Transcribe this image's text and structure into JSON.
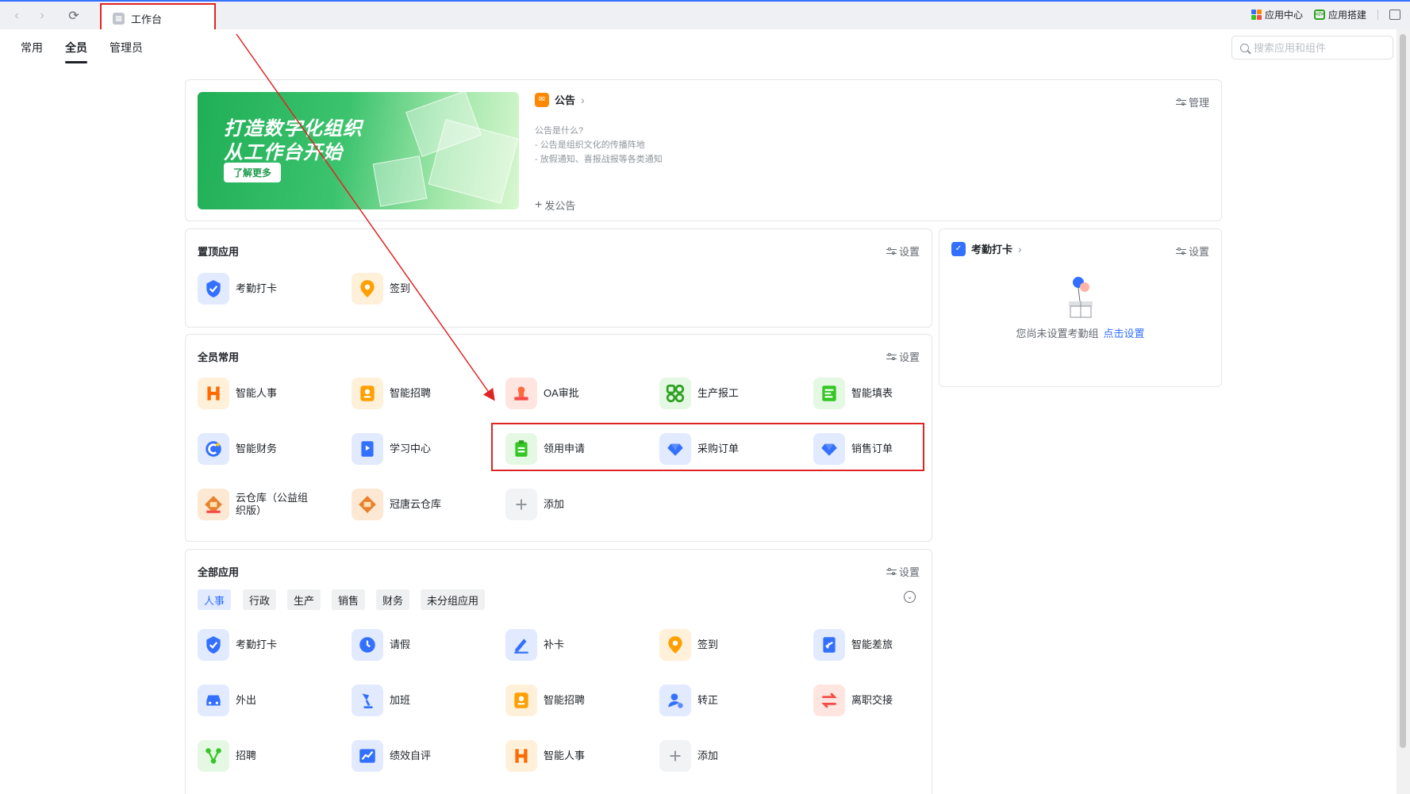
{
  "browser": {
    "tab_label": "工作台",
    "top_actions": [
      "应用中心",
      "应用搭建"
    ]
  },
  "subnav": {
    "tabs": [
      "常用",
      "全员",
      "管理员"
    ],
    "active_tab": "全员",
    "search_placeholder": "搜索应用和组件"
  },
  "banner": {
    "line1": "打造数字化组织",
    "line2": "从工作台开始",
    "button": "了解更多"
  },
  "announcement": {
    "title": "公告",
    "manage": "管理",
    "lines": [
      "公告是什么?",
      "- 公告是组织文化的传播阵地",
      "- 放假通知、喜报战报等各类通知"
    ],
    "post": "发公告"
  },
  "pinned": {
    "title": "置顶应用",
    "setting": "设置",
    "apps": [
      {
        "label": "考勤打卡",
        "icon": "shield-check-icon"
      },
      {
        "label": "签到",
        "icon": "location-pin-icon"
      }
    ]
  },
  "attendance": {
    "title": "考勤打卡",
    "setting": "设置",
    "empty_text": "您尚未设置考勤组",
    "empty_link": "点击设置"
  },
  "common": {
    "title": "全员常用",
    "setting": "设置",
    "apps": [
      {
        "label": "智能人事",
        "icon": "h-logo-icon"
      },
      {
        "label": "智能招聘",
        "icon": "badge-icon"
      },
      {
        "label": "OA审批",
        "icon": "stamp-icon"
      },
      {
        "label": "生产报工",
        "icon": "grid-88-icon"
      },
      {
        "label": "智能填表",
        "icon": "form-icon"
      },
      {
        "label": "智能财务",
        "icon": "finance-icon"
      },
      {
        "label": "学习中心",
        "icon": "book-icon"
      },
      {
        "label": "领用申请",
        "icon": "clipboard-icon"
      },
      {
        "label": "采购订单",
        "icon": "diamond-heart-icon"
      },
      {
        "label": "销售订单",
        "icon": "diamond-heart-icon"
      },
      {
        "label": "云仓库（公益组织版）",
        "icon": "warehouse-icon"
      },
      {
        "label": "冠唐云仓库",
        "icon": "warehouse-icon"
      },
      {
        "label": "添加",
        "icon": "plus-icon"
      }
    ]
  },
  "all_apps": {
    "title": "全部应用",
    "setting": "设置",
    "categories": [
      "人事",
      "行政",
      "生产",
      "销售",
      "财务",
      "未分组应用"
    ],
    "active_category": "人事",
    "apps": [
      {
        "label": "考勤打卡",
        "icon": "shield-check-icon"
      },
      {
        "label": "请假",
        "icon": "clock-icon"
      },
      {
        "label": "补卡",
        "icon": "pen-icon"
      },
      {
        "label": "签到",
        "icon": "location-pin-icon"
      },
      {
        "label": "智能差旅",
        "icon": "plane-icon"
      },
      {
        "label": "外出",
        "icon": "car-icon"
      },
      {
        "label": "加班",
        "icon": "lamp-icon"
      },
      {
        "label": "智能招聘",
        "icon": "badge-icon"
      },
      {
        "label": "转正",
        "icon": "user-icon"
      },
      {
        "label": "离职交接",
        "icon": "swap-icon"
      },
      {
        "label": "招聘",
        "icon": "nodes-icon"
      },
      {
        "label": "绩效自评",
        "icon": "chart-icon"
      },
      {
        "label": "智能人事",
        "icon": "h-logo-icon"
      },
      {
        "label": "添加",
        "icon": "plus-icon"
      }
    ]
  },
  "colors": {
    "accent": "#3370ff",
    "annotation_red": "#e02424"
  }
}
